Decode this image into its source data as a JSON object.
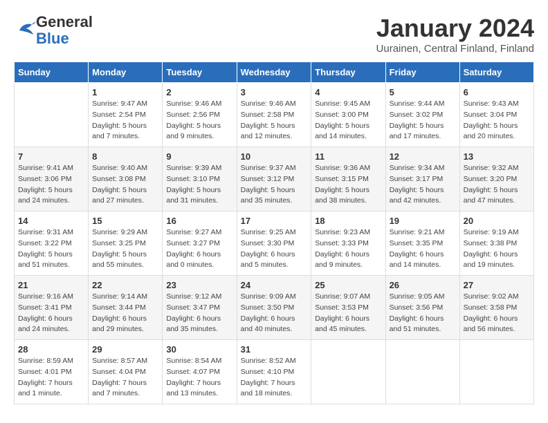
{
  "logo": {
    "line1": "General",
    "line2": "Blue"
  },
  "title": "January 2024",
  "location": "Uurainen, Central Finland, Finland",
  "days_of_week": [
    "Sunday",
    "Monday",
    "Tuesday",
    "Wednesday",
    "Thursday",
    "Friday",
    "Saturday"
  ],
  "weeks": [
    [
      {
        "num": "",
        "info": ""
      },
      {
        "num": "1",
        "info": "Sunrise: 9:47 AM\nSunset: 2:54 PM\nDaylight: 5 hours\nand 7 minutes."
      },
      {
        "num": "2",
        "info": "Sunrise: 9:46 AM\nSunset: 2:56 PM\nDaylight: 5 hours\nand 9 minutes."
      },
      {
        "num": "3",
        "info": "Sunrise: 9:46 AM\nSunset: 2:58 PM\nDaylight: 5 hours\nand 12 minutes."
      },
      {
        "num": "4",
        "info": "Sunrise: 9:45 AM\nSunset: 3:00 PM\nDaylight: 5 hours\nand 14 minutes."
      },
      {
        "num": "5",
        "info": "Sunrise: 9:44 AM\nSunset: 3:02 PM\nDaylight: 5 hours\nand 17 minutes."
      },
      {
        "num": "6",
        "info": "Sunrise: 9:43 AM\nSunset: 3:04 PM\nDaylight: 5 hours\nand 20 minutes."
      }
    ],
    [
      {
        "num": "7",
        "info": "Sunrise: 9:41 AM\nSunset: 3:06 PM\nDaylight: 5 hours\nand 24 minutes."
      },
      {
        "num": "8",
        "info": "Sunrise: 9:40 AM\nSunset: 3:08 PM\nDaylight: 5 hours\nand 27 minutes."
      },
      {
        "num": "9",
        "info": "Sunrise: 9:39 AM\nSunset: 3:10 PM\nDaylight: 5 hours\nand 31 minutes."
      },
      {
        "num": "10",
        "info": "Sunrise: 9:37 AM\nSunset: 3:12 PM\nDaylight: 5 hours\nand 35 minutes."
      },
      {
        "num": "11",
        "info": "Sunrise: 9:36 AM\nSunset: 3:15 PM\nDaylight: 5 hours\nand 38 minutes."
      },
      {
        "num": "12",
        "info": "Sunrise: 9:34 AM\nSunset: 3:17 PM\nDaylight: 5 hours\nand 42 minutes."
      },
      {
        "num": "13",
        "info": "Sunrise: 9:32 AM\nSunset: 3:20 PM\nDaylight: 5 hours\nand 47 minutes."
      }
    ],
    [
      {
        "num": "14",
        "info": "Sunrise: 9:31 AM\nSunset: 3:22 PM\nDaylight: 5 hours\nand 51 minutes."
      },
      {
        "num": "15",
        "info": "Sunrise: 9:29 AM\nSunset: 3:25 PM\nDaylight: 5 hours\nand 55 minutes."
      },
      {
        "num": "16",
        "info": "Sunrise: 9:27 AM\nSunset: 3:27 PM\nDaylight: 6 hours\nand 0 minutes."
      },
      {
        "num": "17",
        "info": "Sunrise: 9:25 AM\nSunset: 3:30 PM\nDaylight: 6 hours\nand 5 minutes."
      },
      {
        "num": "18",
        "info": "Sunrise: 9:23 AM\nSunset: 3:33 PM\nDaylight: 6 hours\nand 9 minutes."
      },
      {
        "num": "19",
        "info": "Sunrise: 9:21 AM\nSunset: 3:35 PM\nDaylight: 6 hours\nand 14 minutes."
      },
      {
        "num": "20",
        "info": "Sunrise: 9:19 AM\nSunset: 3:38 PM\nDaylight: 6 hours\nand 19 minutes."
      }
    ],
    [
      {
        "num": "21",
        "info": "Sunrise: 9:16 AM\nSunset: 3:41 PM\nDaylight: 6 hours\nand 24 minutes."
      },
      {
        "num": "22",
        "info": "Sunrise: 9:14 AM\nSunset: 3:44 PM\nDaylight: 6 hours\nand 29 minutes."
      },
      {
        "num": "23",
        "info": "Sunrise: 9:12 AM\nSunset: 3:47 PM\nDaylight: 6 hours\nand 35 minutes."
      },
      {
        "num": "24",
        "info": "Sunrise: 9:09 AM\nSunset: 3:50 PM\nDaylight: 6 hours\nand 40 minutes."
      },
      {
        "num": "25",
        "info": "Sunrise: 9:07 AM\nSunset: 3:53 PM\nDaylight: 6 hours\nand 45 minutes."
      },
      {
        "num": "26",
        "info": "Sunrise: 9:05 AM\nSunset: 3:56 PM\nDaylight: 6 hours\nand 51 minutes."
      },
      {
        "num": "27",
        "info": "Sunrise: 9:02 AM\nSunset: 3:58 PM\nDaylight: 6 hours\nand 56 minutes."
      }
    ],
    [
      {
        "num": "28",
        "info": "Sunrise: 8:59 AM\nSunset: 4:01 PM\nDaylight: 7 hours\nand 1 minute."
      },
      {
        "num": "29",
        "info": "Sunrise: 8:57 AM\nSunset: 4:04 PM\nDaylight: 7 hours\nand 7 minutes."
      },
      {
        "num": "30",
        "info": "Sunrise: 8:54 AM\nSunset: 4:07 PM\nDaylight: 7 hours\nand 13 minutes."
      },
      {
        "num": "31",
        "info": "Sunrise: 8:52 AM\nSunset: 4:10 PM\nDaylight: 7 hours\nand 18 minutes."
      },
      {
        "num": "",
        "info": ""
      },
      {
        "num": "",
        "info": ""
      },
      {
        "num": "",
        "info": ""
      }
    ]
  ]
}
